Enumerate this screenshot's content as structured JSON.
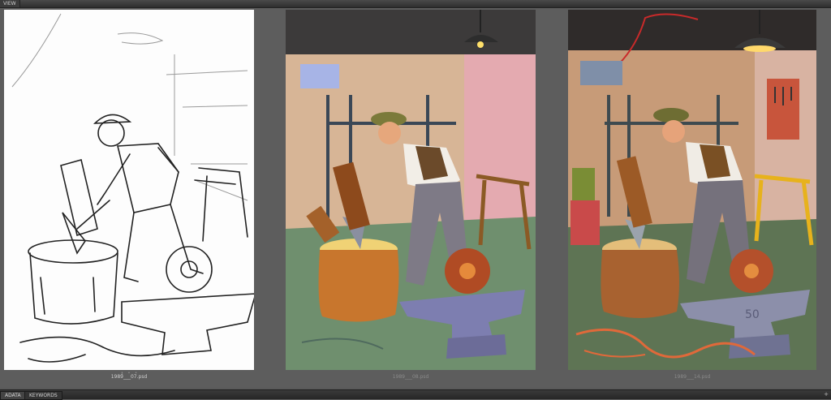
{
  "panel": {
    "tab": "VIEW"
  },
  "thumbnails": [
    {
      "filename": "1989___07.psd",
      "stage": "sketch"
    },
    {
      "filename": "1989___08.psd",
      "stage": "color"
    },
    {
      "filename": "1989___14.psd",
      "stage": "final"
    }
  ],
  "anvil_mark": "50",
  "bottom_tabs": [
    "ADATA",
    "KEYWORDS"
  ],
  "bottom_plus": "+",
  "colors": {
    "panel_bg": "#5d5d5d",
    "wall": "#d9b497",
    "floor": "#6f8f6e",
    "stump": "#c8762d",
    "cap": "#7b7a3a",
    "vest": "#6b4a2a"
  }
}
